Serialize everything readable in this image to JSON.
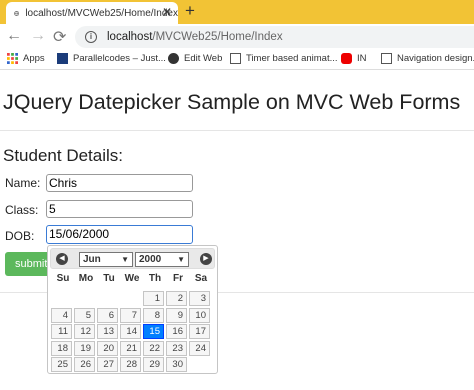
{
  "browser": {
    "tab_title": "localhost/MVCWeb25/Home/Index",
    "new_tab": "+",
    "close": "✕",
    "url_host": "localhost",
    "url_path": "/MVCWeb25/Home/Index",
    "nav": {
      "back": "←",
      "forward": "→",
      "reload": "⟳"
    },
    "bookmarks": [
      {
        "label": "Apps",
        "icon": "apps-grid-icon"
      },
      {
        "label": "Parallelcodes – Just...",
        "icon": "parallelcodes-icon"
      },
      {
        "label": "Edit Web",
        "icon": "github-icon"
      },
      {
        "label": "Timer based animat...",
        "icon": "page-icon"
      },
      {
        "label": "IN",
        "icon": "youtube-icon"
      },
      {
        "label": "Navigation design...",
        "icon": "page-icon"
      }
    ]
  },
  "page": {
    "title": "JQuery Datepicker Sample on MVC Web Forms",
    "subtitle": "Student Details:",
    "fields": [
      {
        "label": "Name:",
        "value": "Chris"
      },
      {
        "label": "Class:",
        "value": "5"
      },
      {
        "label": "DOB:",
        "value": "15/06/2000"
      }
    ],
    "submit_label": "submit"
  },
  "datepicker": {
    "prev": "◀",
    "next": "▶",
    "month": "Jun",
    "year": "2000",
    "weekdays": [
      "Su",
      "Mo",
      "Tu",
      "We",
      "Th",
      "Fr",
      "Sa"
    ],
    "selected_day": "15",
    "weeks": [
      [
        "",
        "",
        "",
        "",
        "1",
        "2",
        "3"
      ],
      [
        "4",
        "5",
        "6",
        "7",
        "8",
        "9",
        "10"
      ],
      [
        "11",
        "12",
        "13",
        "14",
        "15",
        "16",
        "17"
      ],
      [
        "18",
        "19",
        "20",
        "21",
        "22",
        "23",
        "24"
      ],
      [
        "25",
        "26",
        "27",
        "28",
        "29",
        "30",
        ""
      ]
    ]
  },
  "colors": {
    "tabbar": "#f2c335",
    "submit": "#5cb85c",
    "selected_day": "#007fff"
  }
}
